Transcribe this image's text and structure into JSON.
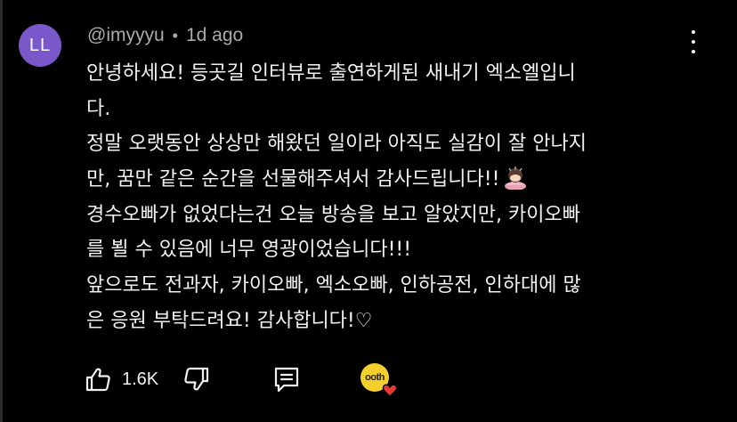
{
  "comment": {
    "avatar_initials": "LL",
    "author": "@imyyyu",
    "separator": "•",
    "timestamp": "1d ago",
    "lines": [
      "안녕하세요! 등곳길 인터뷰로 출연하게된 새내기 엑소엘입니",
      "다.",
      "정말 오랫동안 상상만 해왔던 일이라 아직도 실감이 잘 안나지",
      "만, 꿈만 같은 순간을 선물해주셔서 감사드립니다!!",
      "경수오빠가 없었다는건 오늘 방송을 보고 알았지만, 카이오빠",
      "를 뵐 수 있음에 너무 영광이었습니다!!!",
      "앞으로도 전과자, 카이오빠, 엑소오빠, 인하공전, 인하대에 많",
      "은 응원 부탁드려요! 감사합니다!♡"
    ],
    "emoji_after_line": "bowing-person-emoji"
  },
  "actions": {
    "like_count": "1.6K",
    "creator_heart_avatar_text": "ooth"
  },
  "colors": {
    "background": "#000000",
    "text": "#f1f1f1",
    "meta": "#aaaaaa",
    "avatar": "#7b58c9",
    "heart": "#e53935",
    "creator_avatar": "#f5cf2b"
  }
}
